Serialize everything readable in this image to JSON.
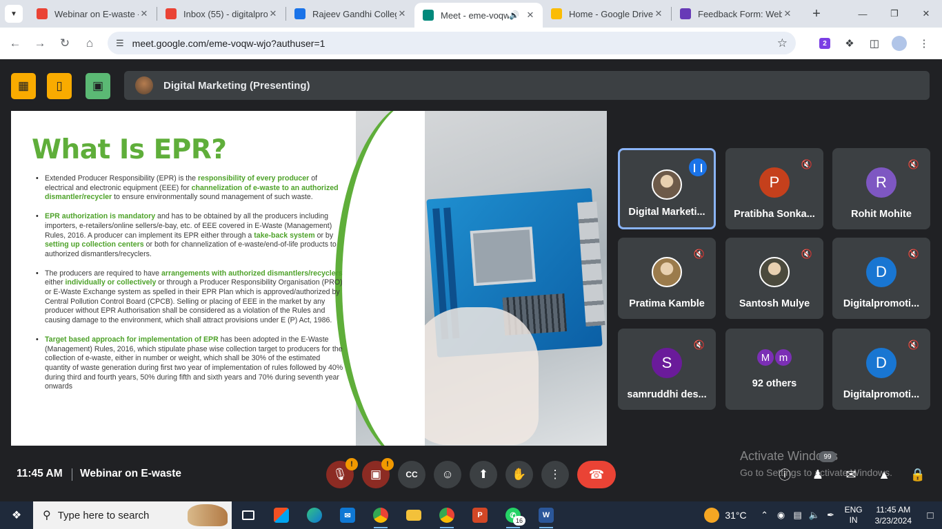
{
  "browser": {
    "tabs": [
      {
        "title": "Webinar on E-waste -",
        "favicon": "gmail-icon",
        "color": "#ea4335",
        "active": false
      },
      {
        "title": "Inbox (55) - digitalpro",
        "favicon": "gmail-icon",
        "color": "#ea4335",
        "active": false
      },
      {
        "title": "Rajeev Gandhi College",
        "favicon": "calendar-icon",
        "color": "#1a73e8",
        "active": false
      },
      {
        "title": "Meet - eme-voqw-wjo",
        "favicon": "meet-icon",
        "color": "#00897b",
        "active": true
      },
      {
        "title": "Home - Google Drive",
        "favicon": "drive-icon",
        "color": "#fbbc04",
        "active": false
      },
      {
        "title": "Feedback Form: Webin",
        "favicon": "forms-icon",
        "color": "#673ab7",
        "active": false
      }
    ],
    "url": "meet.google.com/eme-voqw-wjo?authuser=1",
    "ext_badge": "2"
  },
  "meet": {
    "presenter_label": "Digital Marketing (Presenting)",
    "clock": "11:45 AM",
    "meeting_title": "Webinar on E-waste",
    "people_badge": "99",
    "activate_line1": "Activate Windows",
    "activate_line2": "Go to Settings to activate Windows."
  },
  "slide": {
    "title": "What Is EPR?",
    "bullets": [
      [
        {
          "t": "Extended Producer Responsibility (EPR) is the "
        },
        {
          "t": "responsibility of every producer",
          "h": true
        },
        {
          "t": " of electrical and electronic equipment (EEE) for "
        },
        {
          "t": "channelization of e-waste to an authorized dismantler/recycler",
          "h": true
        },
        {
          "t": " to ensure environmentally sound management of such waste."
        }
      ],
      [
        {
          "t": "EPR authorization is mandatory",
          "h": true
        },
        {
          "t": " and has to be obtained by all the producers including importers, e-retailers/online sellers/e-bay, etc. of EEE covered in E-Waste (Management) Rules, 2016. A producer can implement its EPR either through a "
        },
        {
          "t": "take-back system",
          "h": true
        },
        {
          "t": " or by "
        },
        {
          "t": "setting up collection centers",
          "h": true
        },
        {
          "t": " or both for channelization of e-waste/end-of-life products to authorized dismantlers/recyclers."
        }
      ],
      [
        {
          "t": "The producers are required to have "
        },
        {
          "t": "arrangements with authorized dismantlers/recyclers",
          "h": true
        },
        {
          "t": " either "
        },
        {
          "t": "individually or collectively",
          "h": true
        },
        {
          "t": " or through a Producer Responsibility Organisation (PRO) or E-Waste Exchange system as spelled in their EPR Plan which is approved/authorized by Central Pollution Control Board (CPCB). Selling or placing of EEE in the market by any producer without EPR Authorisation shall be considered as a violation of the Rules and causing damage to the environment, which shall attract provisions under E (P) Act, 1986."
        }
      ],
      [
        {
          "t": "Target based approach for implementation of EPR",
          "h": true
        },
        {
          "t": " has been adopted in the E-Waste (Management) Rules, 2016, which stipulate phase wise collection target to producers for the collection of e-waste, either in number or weight, which shall be 30% of the estimated quantity of waste generation during first two year of implementation of rules followed by 40% during third and fourth years, 50% during fifth and sixth years and 70% during seventh year onwards"
        }
      ]
    ]
  },
  "participants": [
    {
      "name": "Digital Marketi...",
      "initial": "",
      "color": "#6d5a49",
      "photo": true,
      "speaking": true
    },
    {
      "name": "Pratibha Sonka...",
      "initial": "P",
      "color": "#c5401c",
      "photo": false,
      "speaking": false
    },
    {
      "name": "Rohit Mohite",
      "initial": "R",
      "color": "#7e57c2",
      "photo": false,
      "speaking": false
    },
    {
      "name": "Pratima Kamble",
      "initial": "",
      "color": "#9b7b4c",
      "photo": true,
      "speaking": false
    },
    {
      "name": "Santosh Mulye",
      "initial": "",
      "color": "#4b4a3d",
      "photo": true,
      "speaking": false
    },
    {
      "name": "Digitalpromoti...",
      "initial": "D",
      "color": "#1976d2",
      "photo": false,
      "speaking": false
    },
    {
      "name": "samruddhi des...",
      "initial": "S",
      "color": "#6a1b9a",
      "photo": false,
      "speaking": false
    },
    {
      "name": "92 others",
      "initial": "",
      "color": "#7b2fb5",
      "photo": false,
      "speaking": false,
      "others": [
        "M",
        "m"
      ]
    },
    {
      "name": "Digitalpromoti...",
      "initial": "D",
      "color": "#1976d2",
      "photo": false,
      "speaking": false
    }
  ],
  "taskbar": {
    "search_placeholder": "Type here to search",
    "whatsapp_count": "16",
    "temperature": "31°C",
    "lang_top": "ENG",
    "lang_bottom": "IN",
    "time": "11:45 AM",
    "date": "3/23/2024"
  }
}
